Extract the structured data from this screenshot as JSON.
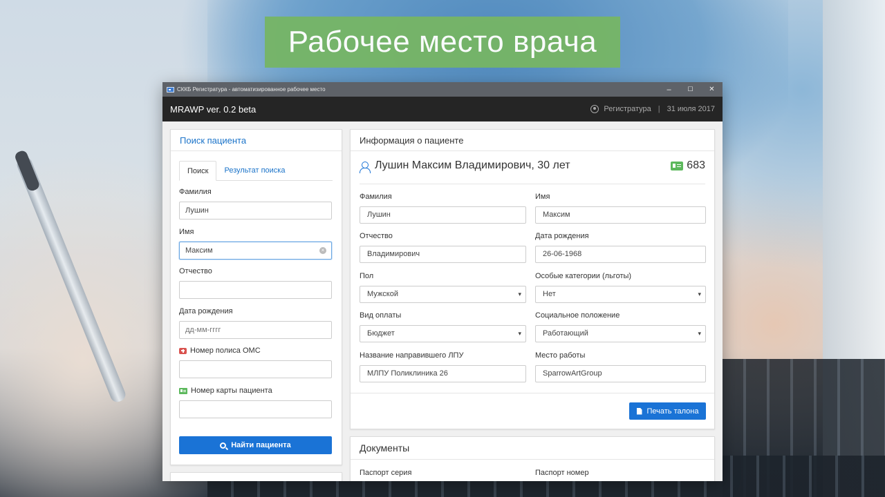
{
  "hero": {
    "title": "Рабочее место врача"
  },
  "window": {
    "title": "СККБ Регистратура - автоматизированное рабочее место",
    "controls": {
      "minimize": "–",
      "maximize": "☐",
      "close": "✕"
    }
  },
  "appbar": {
    "app_name": "MRAWP ver. 0.2 beta",
    "user_role": "Регистратура",
    "separator": "|",
    "date": "31 июля 2017"
  },
  "search": {
    "header": "Поиск пациента",
    "tabs": [
      {
        "label": "Поиск",
        "active": true
      },
      {
        "label": "Результат поиска",
        "active": false
      }
    ],
    "fields": {
      "last_name": {
        "label": "Фамилия",
        "value": "Лушин",
        "placeholder": ""
      },
      "first_name": {
        "label": "Имя",
        "value": "Максим",
        "placeholder": ""
      },
      "patronymic": {
        "label": "Отчество",
        "value": "",
        "placeholder": ""
      },
      "birth_date": {
        "label": "Дата рождения",
        "value": "",
        "placeholder": "дд-мм-гггг"
      },
      "policy": {
        "label": "Номер полиса ОМС",
        "value": "",
        "icon": "medical-kit-icon"
      },
      "card": {
        "label": "Номер карты пациента",
        "value": "",
        "icon": "id-card-icon"
      }
    },
    "button": "Найти пациента"
  },
  "patient": {
    "header": "Информация о пациенте",
    "full_name": "Лушин Максим Владимирович, 30 лет",
    "card_number": "683",
    "fields": {
      "last_name": {
        "label": "Фамилия",
        "value": "Лушин"
      },
      "first_name": {
        "label": "Имя",
        "value": "Максим"
      },
      "patronymic": {
        "label": "Отчество",
        "value": "Владимирович"
      },
      "birth_date": {
        "label": "Дата рождения",
        "value": "26-06-1968"
      },
      "sex": {
        "label": "Пол",
        "value": "Мужской"
      },
      "category": {
        "label": "Особые категории (льготы)",
        "value": "Нет"
      },
      "payment": {
        "label": "Вид оплаты",
        "value": "Бюджет"
      },
      "social": {
        "label": "Социальное положение",
        "value": "Работающий"
      },
      "referrer": {
        "label": "Название направившего ЛПУ",
        "value": "МЛПУ Поликлиника 26"
      },
      "workplace": {
        "label": "Место работы",
        "value": "SparrowArtGroup"
      }
    },
    "print_button": "Печать талона"
  },
  "documents": {
    "header": "Документы",
    "passport_series_label": "Паспорт серия",
    "passport_number_label": "Паспорт номер"
  },
  "colors": {
    "hero_green": "#76b567",
    "accent_blue": "#1a73d6",
    "appbar": "#252525",
    "titlebar": "#5e6268"
  }
}
